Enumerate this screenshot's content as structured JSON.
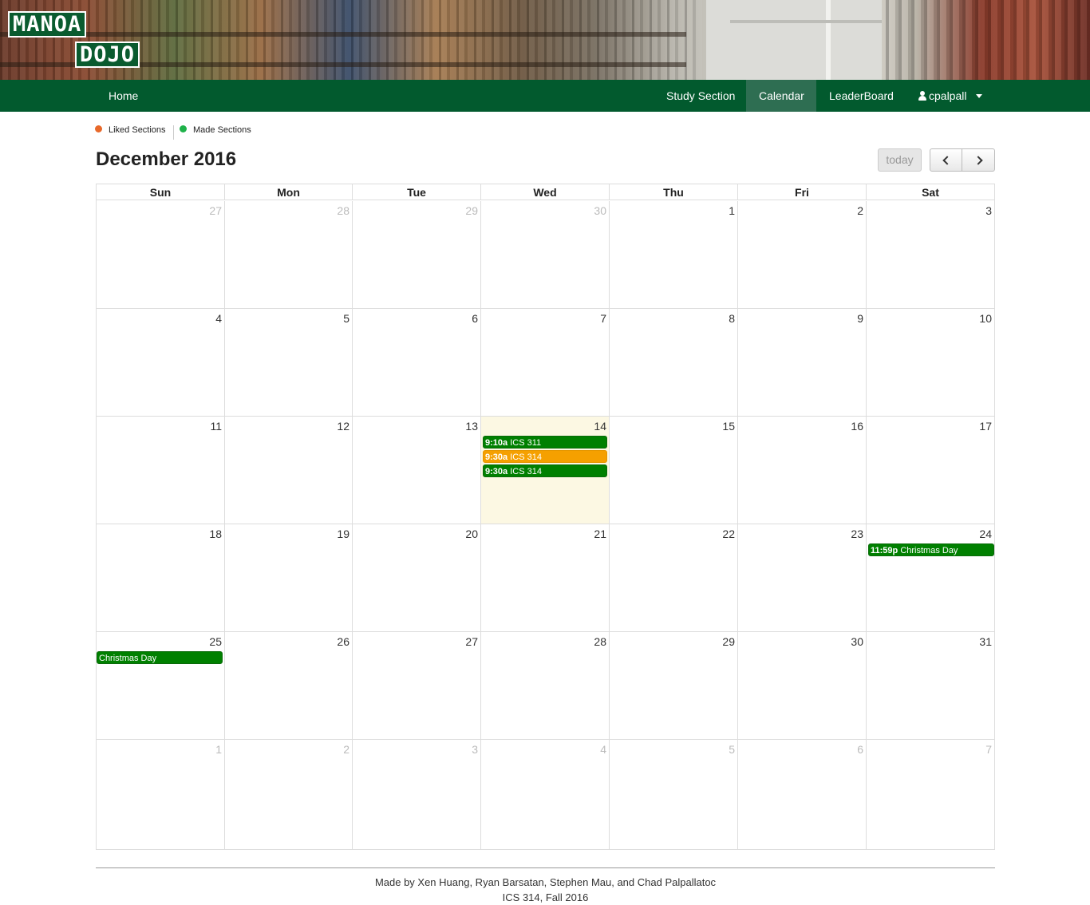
{
  "logo": {
    "line1": "MANOA",
    "line2": "DOJO"
  },
  "nav": {
    "home": "Home",
    "study": "Study Section",
    "calendar": "Calendar",
    "leaderboard": "LeaderBoard",
    "user": "cpalpall"
  },
  "legend": {
    "liked": "Liked Sections",
    "made": "Made Sections",
    "liked_color": "#e8692a",
    "made_color": "#1fb24a"
  },
  "calendar": {
    "title": "December 2016",
    "today_label": "today",
    "weekdays": [
      "Sun",
      "Mon",
      "Tue",
      "Wed",
      "Thu",
      "Fri",
      "Sat"
    ],
    "weeks": [
      [
        {
          "d": "27",
          "other": true
        },
        {
          "d": "28",
          "other": true
        },
        {
          "d": "29",
          "other": true
        },
        {
          "d": "30",
          "other": true
        },
        {
          "d": "1"
        },
        {
          "d": "2"
        },
        {
          "d": "3"
        }
      ],
      [
        {
          "d": "4"
        },
        {
          "d": "5"
        },
        {
          "d": "6"
        },
        {
          "d": "7"
        },
        {
          "d": "8"
        },
        {
          "d": "9"
        },
        {
          "d": "10"
        }
      ],
      [
        {
          "d": "11"
        },
        {
          "d": "12"
        },
        {
          "d": "13"
        },
        {
          "d": "14",
          "today": true,
          "events": [
            {
              "time": "9:10a",
              "title": "ICS 311",
              "color": "green"
            },
            {
              "time": "9:30a",
              "title": "ICS 314",
              "color": "orange"
            },
            {
              "time": "9:30a",
              "title": "ICS 314",
              "color": "green"
            }
          ]
        },
        {
          "d": "15"
        },
        {
          "d": "16"
        },
        {
          "d": "17"
        }
      ],
      [
        {
          "d": "18"
        },
        {
          "d": "19"
        },
        {
          "d": "20"
        },
        {
          "d": "21"
        },
        {
          "d": "22"
        },
        {
          "d": "23"
        },
        {
          "d": "24",
          "events": [
            {
              "time": "11:59p",
              "title": "Christmas Day",
              "color": "green"
            }
          ]
        }
      ],
      [
        {
          "d": "25",
          "events": [
            {
              "time": "",
              "title": "Christmas Day",
              "color": "green"
            }
          ]
        },
        {
          "d": "26"
        },
        {
          "d": "27"
        },
        {
          "d": "28"
        },
        {
          "d": "29"
        },
        {
          "d": "30"
        },
        {
          "d": "31"
        }
      ],
      [
        {
          "d": "1",
          "other": true
        },
        {
          "d": "2",
          "other": true
        },
        {
          "d": "3",
          "other": true
        },
        {
          "d": "4",
          "other": true
        },
        {
          "d": "5",
          "other": true
        },
        {
          "d": "6",
          "other": true
        },
        {
          "d": "7",
          "other": true
        }
      ]
    ]
  },
  "footer": {
    "line1": "Made by Xen Huang, Ryan Barsatan, Stephen Mau, and Chad Palpallatoc",
    "line2": "ICS 314, Fall 2016"
  }
}
